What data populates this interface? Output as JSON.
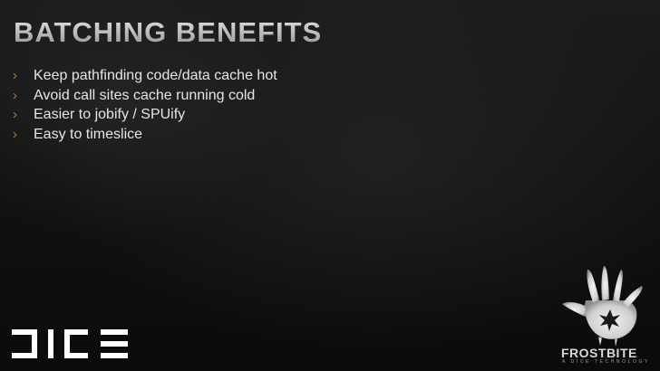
{
  "slide": {
    "title": "BATCHING BENEFITS",
    "bullet_marker": "›",
    "bullet_color": "#b47d2b",
    "bullets": [
      "Keep pathfinding code/data cache hot",
      "Avoid call sites cache running cold",
      "Easier to jobify / SPUify",
      "Easy to timeslice"
    ]
  },
  "logos": {
    "dice": "DICE",
    "frostbite_wordmark": "FROSTBITE",
    "frostbite_tagline": "A DICE TECHNOLOGY",
    "frostbite_icon": "handprint-icon"
  }
}
